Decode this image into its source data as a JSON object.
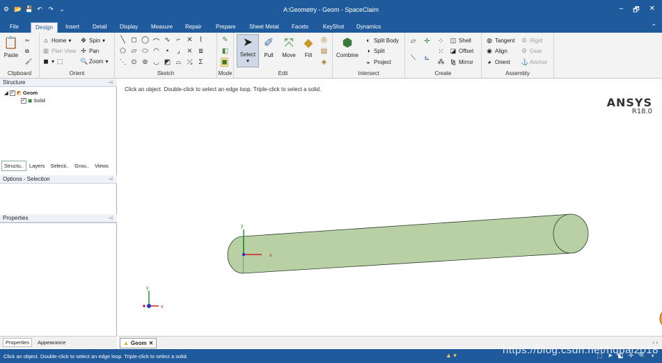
{
  "titlebar": {
    "title": "A:Geometry - Geom - SpaceClaim"
  },
  "menu_tabs": [
    "File",
    "Design",
    "Insert",
    "Detail",
    "Display",
    "Measure",
    "Repair",
    "Prepare",
    "Sheet Metal",
    "Facets",
    "KeyShot",
    "Dynamics"
  ],
  "active_tab": "Design",
  "ribbon": {
    "clipboard": {
      "label": "Clipboard",
      "paste": "Paste"
    },
    "orient": {
      "label": "Orient",
      "home": "Home",
      "spin": "Spin",
      "plan_view": "Plan View",
      "pan": "Pan",
      "zoom": "Zoom"
    },
    "sketch": {
      "label": "Sketch"
    },
    "mode": {
      "label": "Mode"
    },
    "edit": {
      "label": "Edit",
      "select": "Select",
      "pull": "Pull",
      "move": "Move",
      "fill": "Fill"
    },
    "intersect": {
      "label": "Intersect",
      "combine": "Combine",
      "split_body": "Split Body",
      "split": "Split",
      "project": "Project"
    },
    "create": {
      "label": "Create",
      "shell": "Shell",
      "offset": "Offset",
      "mirror": "Mirror"
    },
    "assembly": {
      "label": "Assembly",
      "tangent": "Tangent",
      "rigid": "Rigid",
      "align": "Align",
      "gear": "Gear",
      "orient": "Orient",
      "anchor": "Anchor"
    }
  },
  "structure": {
    "title": "Structure",
    "root": "Geom",
    "child": "Solid"
  },
  "panel_tabs": [
    "Structu..",
    "Layers",
    "Selecti..",
    "Grou..",
    "Views"
  ],
  "options": {
    "title": "Options - Selection"
  },
  "properties": {
    "title": "Properties"
  },
  "bottom_tabs": [
    "Properties",
    "Appearance"
  ],
  "viewport": {
    "hint": "Click an object. Double-click to select an edge loop. Triple-click to select a solid.",
    "brand": "ANSYS",
    "version": "R18.0",
    "axis_x": "x",
    "axis_y": "y"
  },
  "doc_tab": {
    "name": "Geom"
  },
  "statusbar": {
    "message": "Click an object. Double-click to select an edge loop. Triple-click to select a solid."
  },
  "watermark": "https://blog.csdn.net/hqpai2018",
  "colors": {
    "title_blue": "#1f5a9c",
    "cylinder": "#b8d0a4",
    "axis_x": "#d02020",
    "axis_y": "#1a9a2a",
    "axis_z": "#2030d0"
  }
}
